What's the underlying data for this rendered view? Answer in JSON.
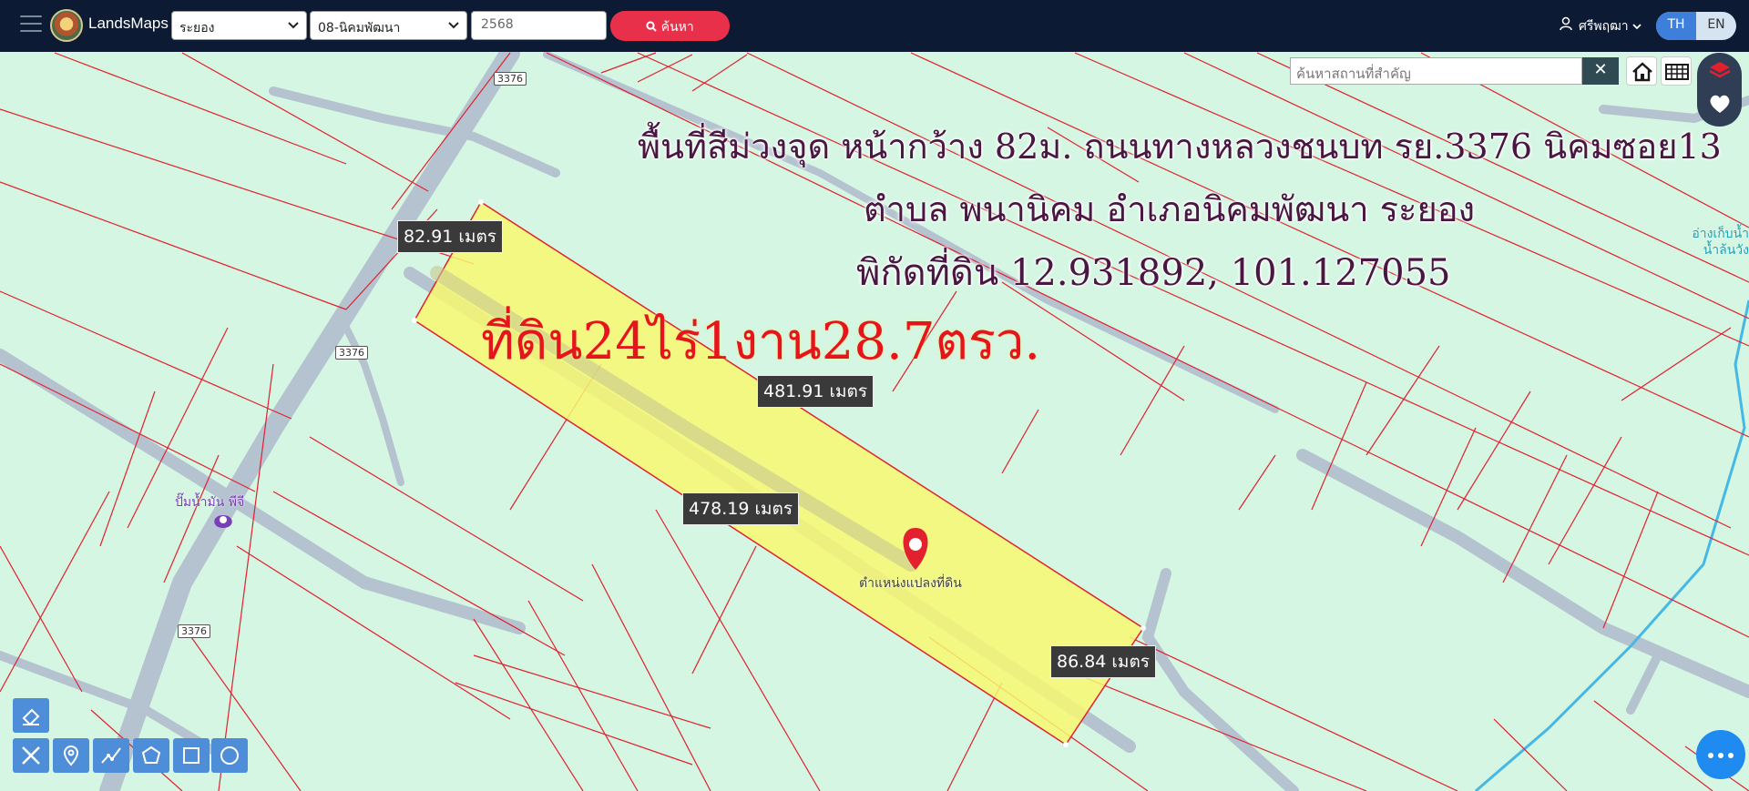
{
  "header": {
    "brand": "LandsMaps",
    "province": "ระยอง",
    "district": "08-นิคมพัฒนา",
    "year": "2568",
    "search_label": "ค้นหา",
    "user_name": "ศรีพฤฒา",
    "lang_th": "TH",
    "lang_en": "EN"
  },
  "map": {
    "search_placeholder": "ค้นหาสถานที่สำคัญ",
    "clear_label": "✕",
    "overlay_line1": "พื้นที่สีม่วงจุด หน้ากว้าง 82ม. ถนนทางหลวงชนบท รย.3376 นิคมซอย13",
    "overlay_line2": "ตำบล พนานิคม อำเภอนิคมพัฒนา ระยอง",
    "overlay_line3": "พิกัดที่ดิน 12.931892, 101.127055",
    "area_text": "ที่ดิน24ไร่1งาน28.7ตรว.",
    "measure_top": "82.91 เมตร",
    "measure_upper_long": "481.91 เมตร",
    "measure_lower_long": "478.19 เมตร",
    "measure_bottom": "86.84 เมตร",
    "road_sign_a": "3376",
    "road_sign_b": "3376",
    "road_sign_c": "3376",
    "poi_gas": "ปั๊มน้ำมัน พีจี",
    "pin_label": "ตำแหน่งแปลงที่ดิน",
    "side_label_1": "อ่างเก็บน้ำ",
    "side_label_2": "น้ำล้นวัง",
    "colors": {
      "parcel_fill": "#f7f871",
      "parcel_line": "#e2202e",
      "road": "#b5c2cf",
      "map_bg": "#d4f6e2"
    }
  }
}
